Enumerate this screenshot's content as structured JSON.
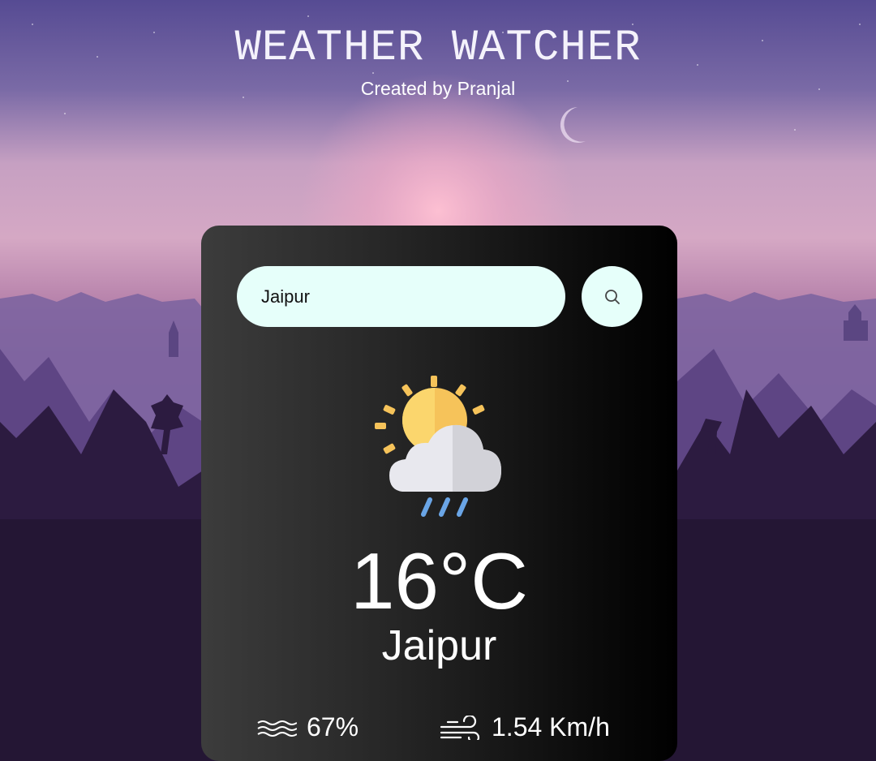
{
  "header": {
    "title": "WEATHER WATCHER",
    "subtitle": "Created by Pranjal"
  },
  "search": {
    "value": "Jaipur"
  },
  "weather": {
    "icon": "sun-cloud-rain-icon",
    "temperature": "16°C",
    "city": "Jaipur",
    "humidity": "67%",
    "wind_speed": "1.54 Km/h"
  },
  "icons": {
    "search": "search-icon",
    "humidity": "humidity-waves-icon",
    "wind": "wind-icon"
  },
  "colors": {
    "sky_top": "#5a4d96",
    "sky_glow": "#f7b6c9",
    "mountain_dark": "#241634",
    "input_bg": "#e6fffa",
    "sun": "#f6c35a"
  }
}
